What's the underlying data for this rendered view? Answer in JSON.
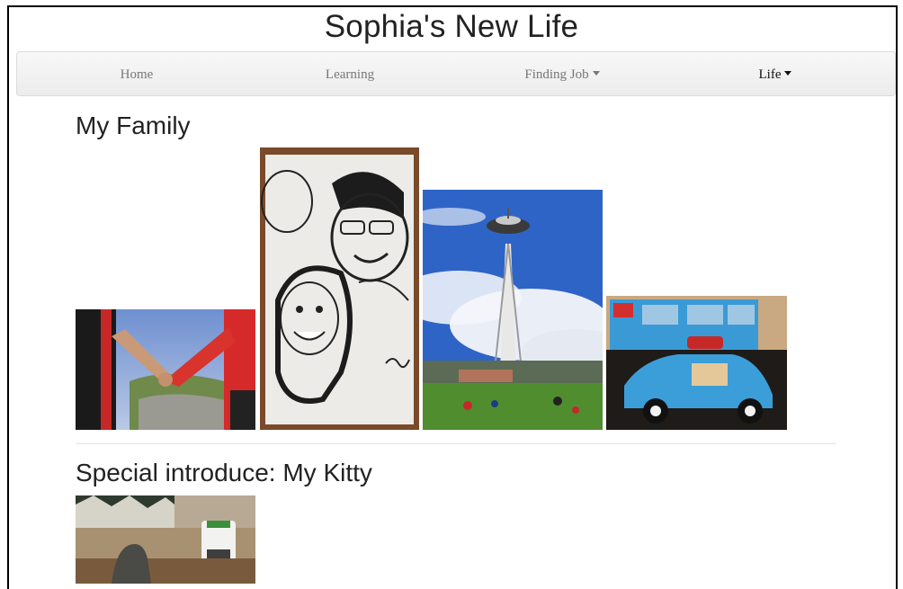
{
  "site": {
    "title": "Sophia's New Life"
  },
  "navbar": {
    "items": [
      {
        "label": "Home",
        "dropdown": false,
        "active": false
      },
      {
        "label": "Learning",
        "dropdown": false,
        "active": false
      },
      {
        "label": "Finding Job",
        "dropdown": true,
        "active": false
      },
      {
        "label": "Life",
        "dropdown": true,
        "active": true
      }
    ]
  },
  "sections": {
    "family": {
      "title": "My Family",
      "photos": [
        {
          "subject": "holding-hands-photo"
        },
        {
          "subject": "caricature-drawing-photo"
        },
        {
          "subject": "space-needle-photo"
        },
        {
          "subject": "lego-beetle-photo"
        }
      ]
    },
    "kitty": {
      "title": "Special introduce: My Kitty",
      "photos": [
        {
          "subject": "kitty-photo"
        }
      ]
    }
  },
  "icons": {
    "dropdown": "caret-down-icon"
  },
  "colors": {
    "text": "#222222",
    "nav_text": "#777777",
    "nav_active": "#111111",
    "navbar_bg": "#f0f0f0"
  }
}
